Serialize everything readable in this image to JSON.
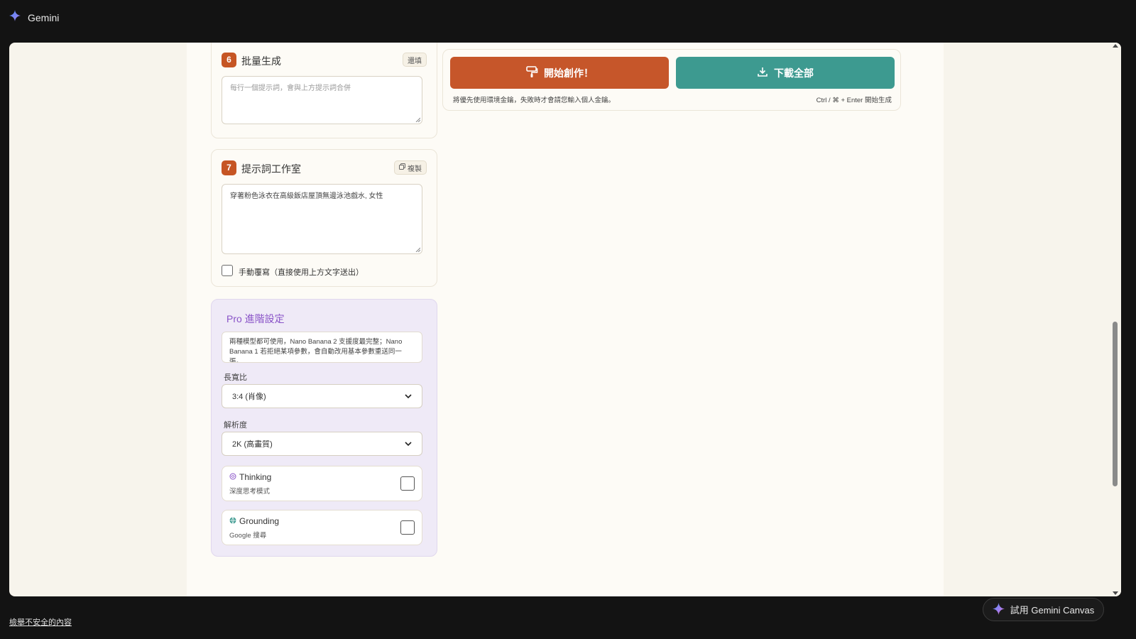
{
  "app": {
    "name": "Gemini"
  },
  "batch": {
    "number": "6",
    "title": "批量生成",
    "clear_label": "還填",
    "placeholder": "每行一個提示詞，會與上方提示詞合併"
  },
  "studio": {
    "number": "7",
    "title": "提示詞工作室",
    "copy_label": "複製",
    "value": "穿著粉色泳衣在高級飯店屋頂無邊泳池戲水, 女性",
    "manual_label": "手動覆寫（直接使用上方文字送出）",
    "manual_checked": false
  },
  "pro": {
    "title": "Pro 進階設定",
    "info": "兩種模型都可使用，Nano Banana 2 支援度最完整；Nano Banana 1 若拒絕某項參數，會自動改用基本參數重送同一張。",
    "aspect_label": "長寬比",
    "aspect_value": "3:4 (肖像)",
    "resolution_label": "解析度",
    "resolution_value": "2K (高畫質)",
    "thinking": {
      "title": "Thinking",
      "subtitle": "深度思考模式",
      "checked": false
    },
    "grounding": {
      "title": "Grounding",
      "subtitle": "Google 搜尋",
      "checked": false
    }
  },
  "actions": {
    "start_label": "開始創作！",
    "download_label": "下載全部",
    "hint_left": "將優先使用環境金鑰，失敗時才會請您輸入個人金鑰。",
    "hint_right": "Ctrl / ⌘ + Enter 開始生成"
  },
  "footer": {
    "report_label": "檢舉不安全的內容",
    "canvas_label": "試用 Gemini Canvas"
  },
  "colors": {
    "accent_orange": "#c6562a",
    "accent_teal": "#3d9a90",
    "pro_purple": "#8a54c8"
  }
}
